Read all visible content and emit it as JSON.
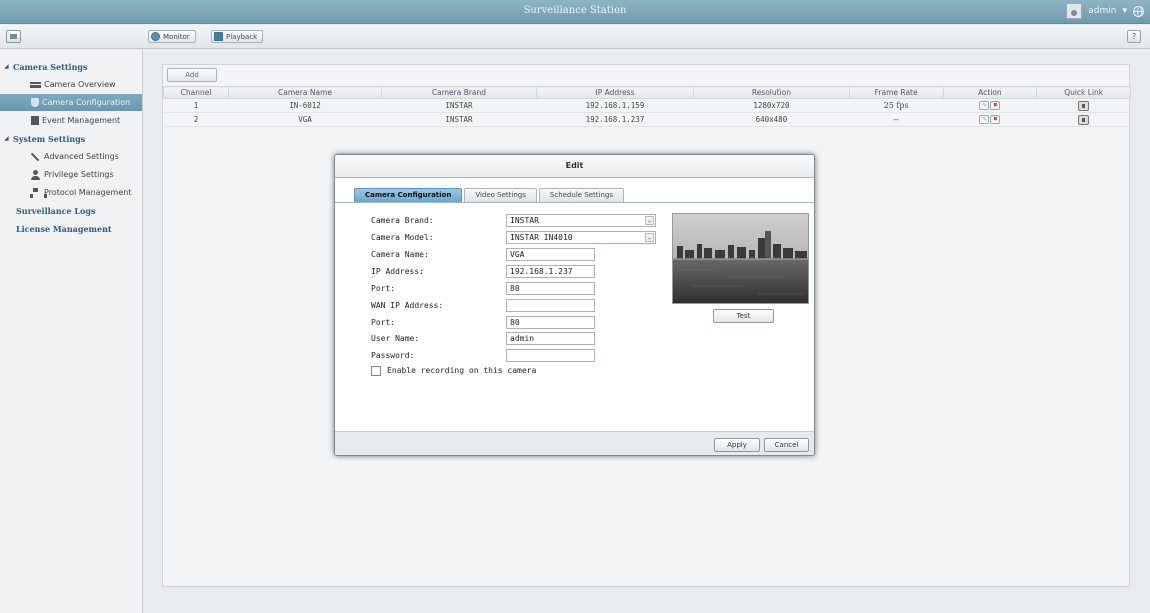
{
  "app": {
    "title": "Surveillance Station",
    "user": "admin"
  },
  "toolbar": {
    "monitor_label": "Monitor",
    "playback_label": "Playback",
    "help_label": "?"
  },
  "sidebar": {
    "camera_settings": "Camera Settings",
    "camera_overview": "Camera Overview",
    "camera_configuration": "Camera Configuration",
    "event_management": "Event Management",
    "system_settings": "System Settings",
    "advanced_settings": "Advanced Settings",
    "privilege_settings": "Privilege Settings",
    "protocol_management": "Protocol Management",
    "surveillance_logs": "Surveillance Logs",
    "license_management": "License Management"
  },
  "camera_table": {
    "add_label": "Add",
    "columns": [
      "Channel",
      "Camera Name",
      "Camera Brand",
      "IP Address",
      "Resolution",
      "Frame Rate",
      "Action",
      "Quick Link"
    ],
    "rows": [
      {
        "channel": "1",
        "name": "IN-6012",
        "brand": "INSTAR",
        "ip": "192.168.1.159",
        "resolution": "1280x720",
        "frame_rate": "25 fps"
      },
      {
        "channel": "2",
        "name": "VGA",
        "brand": "INSTAR",
        "ip": "192.168.1.237",
        "resolution": "640x480",
        "frame_rate": "--"
      }
    ]
  },
  "dialog": {
    "title": "Edit",
    "tabs": [
      "Camera Configuration",
      "Video Settings",
      "Schedule Settings"
    ],
    "labels": {
      "brand": "Camera Brand:",
      "model": "Camera Model:",
      "name": "Camera Name:",
      "ip": "IP Address:",
      "port": "Port:",
      "wan_ip": "WAN IP Address:",
      "port2": "Port:",
      "user": "User Name:",
      "password": "Password:"
    },
    "values": {
      "brand": "INSTAR",
      "model": "INSTAR IN4010",
      "name": "VGA",
      "ip": "192.168.1.237",
      "port": "80",
      "wan_ip": "",
      "port2": "80",
      "user": "admin",
      "password": ""
    },
    "enable_recording_label": "Enable recording on this camera",
    "enable_recording_checked": false,
    "test_label": "Test",
    "apply_label": "Apply",
    "cancel_label": "Cancel"
  }
}
